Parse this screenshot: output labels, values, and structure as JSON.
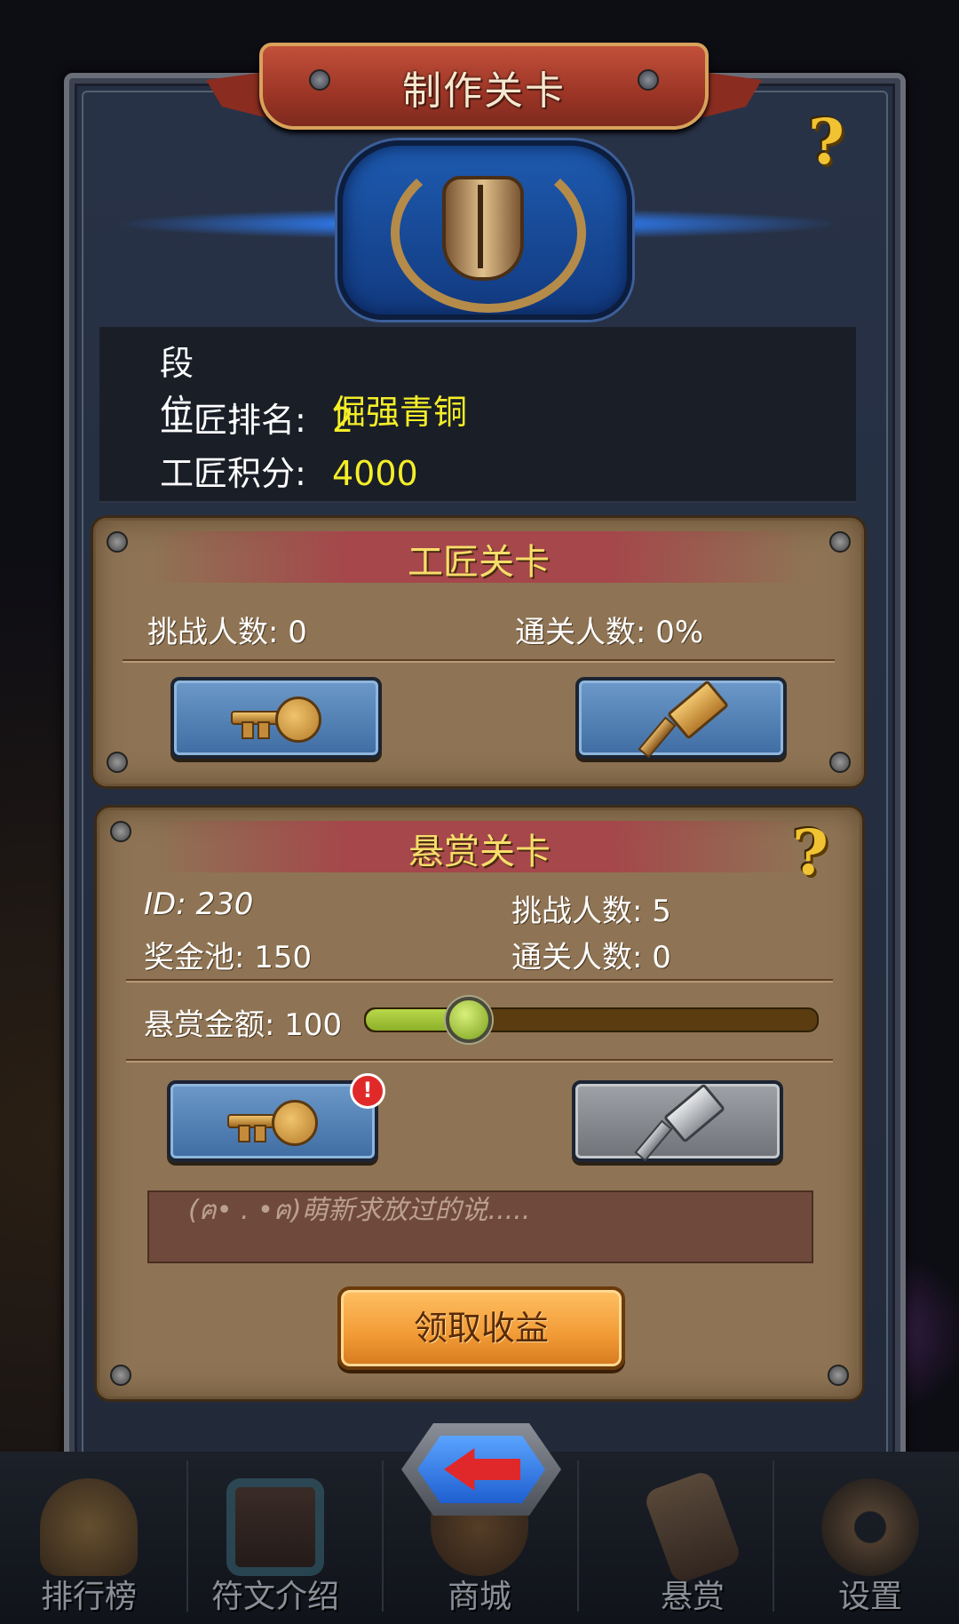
{
  "title": "制作关卡",
  "help_glyph": "?",
  "rank_info": {
    "tier_label": "段位:",
    "tier_value": "倔强青铜",
    "rank_label": "工匠排名:",
    "rank_value": "2",
    "score_label": "工匠积分:",
    "score_value": "4000"
  },
  "craftsman_panel": {
    "header": "工匠关卡",
    "challengers": "挑战人数: 0",
    "clear_rate": "通关人数: 0%"
  },
  "bounty_panel": {
    "header": "悬赏关卡",
    "id": "ID: 230",
    "challengers": "挑战人数: 5",
    "prize_pool": "奖金池:  150",
    "cleared": "通关人数: 0",
    "bounty_amount": "悬赏金额: 100",
    "slider_fraction": 0.22,
    "message_placeholder": "(ฅ• . •ฅ)萌新求放过的说.....",
    "claim_button": "领取收益",
    "alert_glyph": "!"
  },
  "nav": [
    {
      "label": "排行榜",
      "icon": "trophy-icon"
    },
    {
      "label": "符文介绍",
      "icon": "rune-book-icon"
    },
    {
      "label": "商城",
      "icon": "shop-bag-icon"
    },
    {
      "label": "悬赏",
      "icon": "scroll-icon"
    },
    {
      "label": "设置",
      "icon": "gear-icon"
    }
  ],
  "colors": {
    "accent_yellow": "#f4ee28",
    "parchment": "#8e7454",
    "blue_button": "#4f7fb5",
    "claim_orange": "#f19a35"
  }
}
